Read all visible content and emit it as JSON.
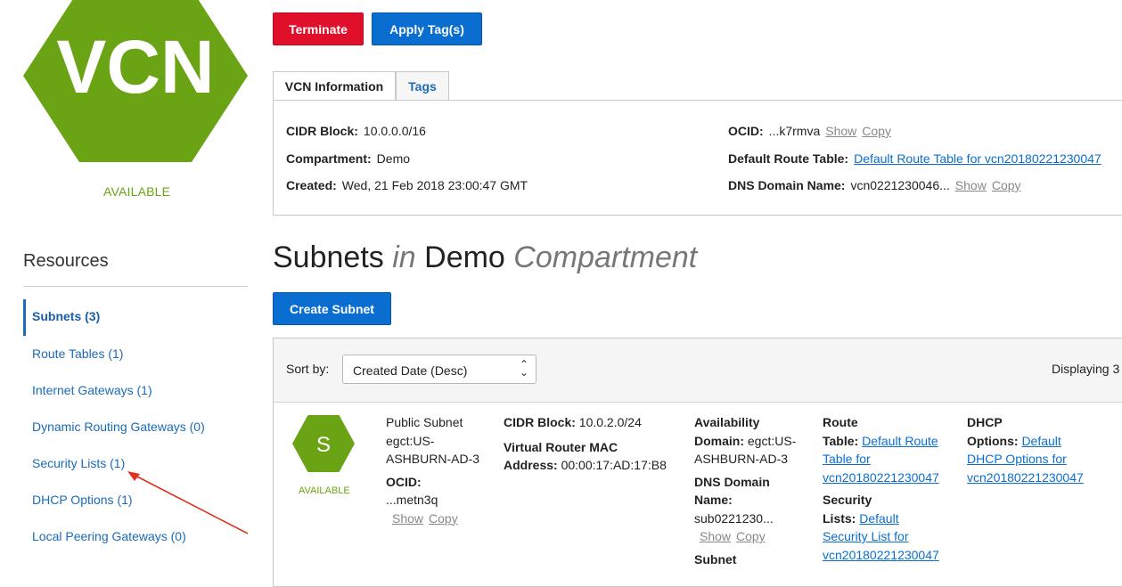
{
  "sidebar": {
    "resource_icon_text": "VCN",
    "resource_status": "AVAILABLE",
    "resources_title": "Resources",
    "items": [
      {
        "label": "Subnets (3)",
        "active": true
      },
      {
        "label": "Route Tables (1)"
      },
      {
        "label": "Internet Gateways (1)"
      },
      {
        "label": "Dynamic Routing Gateways (0)"
      },
      {
        "label": "Security Lists (1)"
      },
      {
        "label": "DHCP Options (1)"
      },
      {
        "label": "Local Peering Gateways (0)"
      }
    ]
  },
  "actions": {
    "terminate": "Terminate",
    "apply_tags": "Apply Tag(s)"
  },
  "tabs": {
    "info": "VCN Information",
    "tags": "Tags"
  },
  "vcn_info": {
    "cidr_label": "CIDR Block:",
    "cidr_value": "10.0.0.0/16",
    "compartment_label": "Compartment:",
    "compartment_value": "Demo",
    "created_label": "Created:",
    "created_value": "Wed, 21 Feb 2018 23:00:47 GMT",
    "ocid_label": "OCID:",
    "ocid_value": "...k7rmva",
    "route_label": "Default Route Table:",
    "route_value": "Default Route Table for vcn20180221230047",
    "dns_label": "DNS Domain Name:",
    "dns_value": "vcn0221230046...",
    "show": "Show",
    "copy": "Copy"
  },
  "heading": {
    "title": "Subnets",
    "in": "in",
    "compartment": "Demo",
    "suffix": "Compartment"
  },
  "create_subnet": "Create Subnet",
  "sort": {
    "label": "Sort by:",
    "selected": "Created Date (Desc)",
    "displaying": "Displaying 3"
  },
  "subnet": {
    "icon_letter": "S",
    "status": "AVAILABLE",
    "name_lines": [
      "Public Subnet",
      "egct:US-",
      "ASHBURN-AD-3"
    ],
    "ocid_label": "OCID:",
    "ocid_value": "...metn3q",
    "cidr_label": "CIDR Block:",
    "cidr_value": "10.0.2.0/24",
    "vr_label_1": "Virtual Router MAC",
    "vr_label_2": "Address:",
    "vr_value": "00:00:17:AD:17:B8",
    "ad_label_1": "Availability",
    "ad_label_2": "Domain:",
    "ad_value_1": "egct:US-",
    "ad_value_2": "ASHBURN-AD-3",
    "dns_label_1": "DNS Domain",
    "dns_label_2": "Name:",
    "dns_value": "sub0221230...",
    "subnet_label": "Subnet",
    "route_label_1": "Route",
    "route_label_2": "Table:",
    "route_link_1": "Default Route",
    "route_link_2": "Table for",
    "route_link_3": "vcn20180221230047",
    "sec_label_1": "Security",
    "sec_label_2": "Lists:",
    "sec_link_1": "Default",
    "sec_link_2": "Security List for",
    "sec_link_3": "vcn20180221230047",
    "dhcp_label_1": "DHCP",
    "dhcp_label_2": "Options:",
    "dhcp_link_1": "Default",
    "dhcp_link_2": "DHCP Options for",
    "dhcp_link_3": "vcn20180221230047",
    "show": "Show",
    "copy": "Copy"
  },
  "colors": {
    "accent": "#0a6ed1",
    "danger": "#e0102b",
    "available": "#6aa414",
    "annotation_arrow": "#e0301e"
  }
}
